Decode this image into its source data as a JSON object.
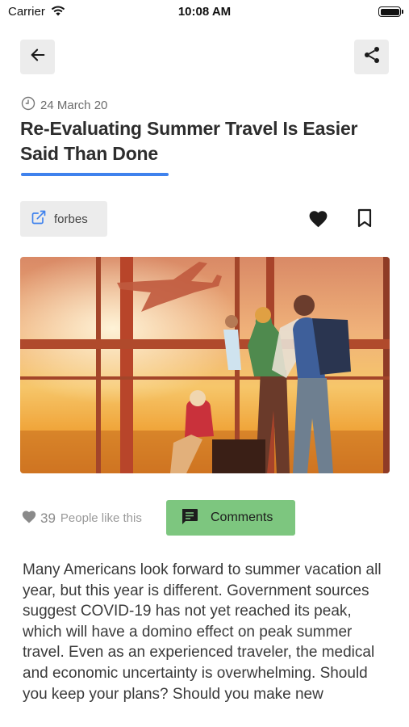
{
  "status_bar": {
    "carrier": "Carrier",
    "time": "10:08 AM"
  },
  "article": {
    "date": "24 March 20",
    "title": "Re-Evaluating Summer Travel Is Easier Said Than Done",
    "source": "forbes",
    "likes_count": "39",
    "likes_text": "People like this",
    "comments_label": "Comments",
    "body": "Many Americans look forward to summer vacation all year, but this year is different. Government sources suggest COVID-19 has not yet reached its peak, which will have a domino effect on peak summer travel. Even as an experienced traveler, the medical and economic uncertainty is overwhelming. Should you keep your plans? Should you make new"
  },
  "colors": {
    "accent": "#3f82ed",
    "comments_button": "#7dc67f",
    "chip_bg": "#ececec"
  },
  "icons": [
    "wifi-icon",
    "battery-icon",
    "back-arrow-icon",
    "share-icon",
    "clock-icon",
    "external-link-icon",
    "heart-icon",
    "bookmark-icon",
    "comment-icon"
  ]
}
